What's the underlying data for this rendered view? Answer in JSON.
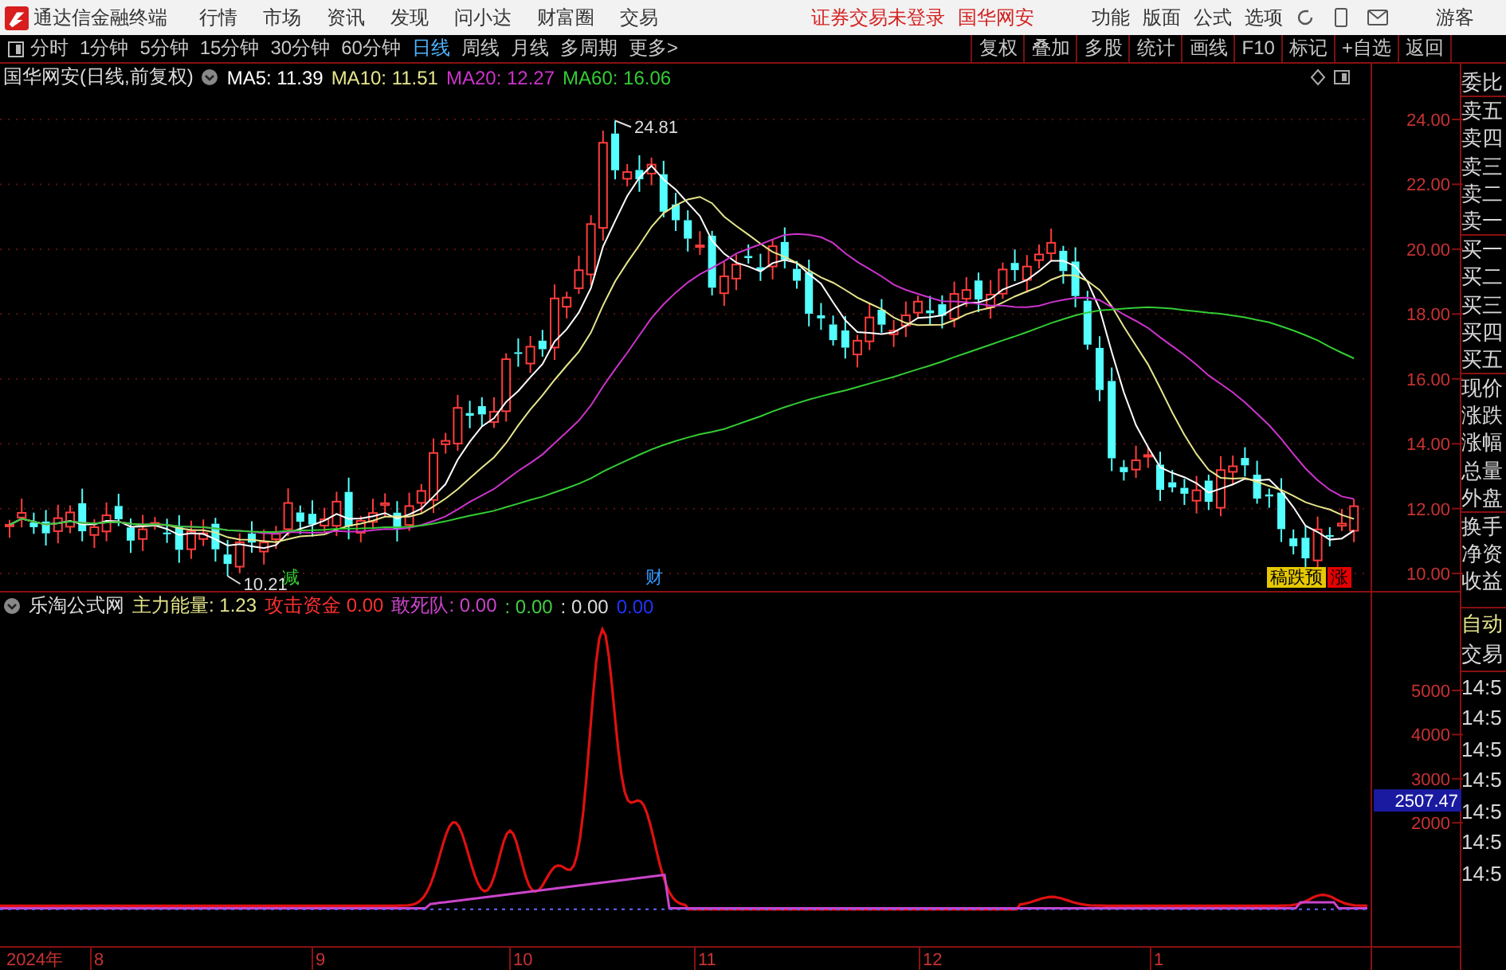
{
  "menubar": {
    "app_title": "通达信金融终端",
    "menus": [
      "行情",
      "市场",
      "资讯",
      "发现",
      "问小达",
      "财富圈",
      "交易"
    ],
    "notice": "证券交易未登录",
    "stock": "国华网安",
    "tools": [
      "功能",
      "版面",
      "公式",
      "选项"
    ],
    "user": "游客"
  },
  "toolbar": {
    "periods": [
      {
        "label": "分时",
        "selected": false
      },
      {
        "label": "1分钟",
        "selected": false
      },
      {
        "label": "5分钟",
        "selected": false
      },
      {
        "label": "15分钟",
        "selected": false
      },
      {
        "label": "30分钟",
        "selected": false
      },
      {
        "label": "60分钟",
        "selected": false
      },
      {
        "label": "日线",
        "selected": true
      },
      {
        "label": "周线",
        "selected": false
      },
      {
        "label": "月线",
        "selected": false
      },
      {
        "label": "多周期",
        "selected": false
      },
      {
        "label": "更多>",
        "selected": false
      }
    ],
    "actions": [
      "复权",
      "叠加",
      "多股",
      "统计",
      "画线",
      "F10",
      "标记",
      "+自选",
      "返回"
    ]
  },
  "main_chart": {
    "title": "国华网安(日线,前复权)",
    "ma_legend": [
      {
        "text": "MA5: 11.39",
        "color": "#ffffff"
      },
      {
        "text": "MA10: 11.51",
        "color": "#e6e68c"
      },
      {
        "text": "MA20: 12.27",
        "color": "#cc33cc"
      },
      {
        "text": "MA60: 16.06",
        "color": "#33cc33"
      }
    ],
    "high_label": "24.81",
    "low_label": "10.21",
    "markers": [
      {
        "text": "减",
        "kind": "text",
        "color": "#33cc33"
      },
      {
        "text": "财",
        "kind": "text",
        "color": "#3399ff"
      },
      {
        "text": "稿跌预",
        "kind": "tag",
        "color": "#e6c800"
      },
      {
        "text": "涨",
        "kind": "tag",
        "color": "#e60000"
      }
    ],
    "price_ticks": [
      "24.00",
      "22.00",
      "20.00",
      "18.00",
      "16.00",
      "14.00",
      "12.00",
      "10.00"
    ]
  },
  "indicator": {
    "title": "乐淘公式网",
    "values": [
      {
        "text": "主力能量: 1.23",
        "color": "#e6e68c"
      },
      {
        "text": "攻击资金 0.00",
        "color": "#ff3030"
      },
      {
        "text": "敢死队: 0.00",
        "color": "#cc44cc"
      },
      {
        "text": ": 0.00",
        "color": "#44cc44"
      },
      {
        "text": ": 0.00",
        "color": "#dddddd"
      },
      {
        "text": "0.00",
        "color": "#2233ff"
      }
    ],
    "ticks": [
      "5000",
      "4000",
      "3000",
      "2000"
    ],
    "cursor_value": "2507.47"
  },
  "date_axis": [
    "2024年",
    "8",
    "9",
    "10",
    "11",
    "12",
    "1"
  ],
  "side_panel": {
    "quote_labels": [
      "委比",
      "卖五",
      "卖四",
      "卖三",
      "卖二",
      "卖一",
      "买一",
      "买二",
      "买三",
      "买四",
      "买五",
      "现价",
      "涨跌",
      "涨幅",
      "总量",
      "外盘",
      "换手",
      "净资",
      "收益"
    ],
    "trade_labels": [
      "自动",
      "交易",
      "14:5",
      "14:5",
      "14:5",
      "14:5",
      "14:5",
      "14:5",
      "14:5"
    ]
  }
}
